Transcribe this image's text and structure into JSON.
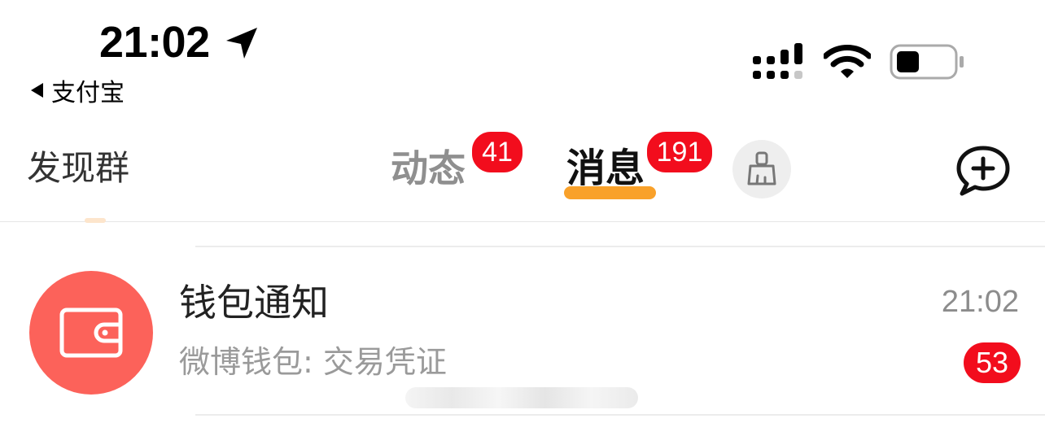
{
  "status_bar": {
    "time": "21:02",
    "back_app": "支付宝",
    "icons": [
      "location-arrow-icon",
      "signal-icon",
      "wifi-icon",
      "battery-icon"
    ],
    "battery_level": 0.4
  },
  "nav": {
    "discover_label": "发现群",
    "tabs": [
      {
        "label": "动态",
        "badge": "41",
        "active": false
      },
      {
        "label": "消息",
        "badge": "191",
        "active": true
      }
    ],
    "actions": [
      "clean-icon",
      "compose-message-icon"
    ],
    "accent_color": "#f9a12a",
    "badge_color": "#f20d1d"
  },
  "conversations": [
    {
      "title": "钱包通知",
      "preview": "微博钱包: 交易凭证",
      "time": "21:02",
      "unread": "53",
      "avatar_icon": "wallet-icon",
      "avatar_color": "#fc625a"
    }
  ]
}
